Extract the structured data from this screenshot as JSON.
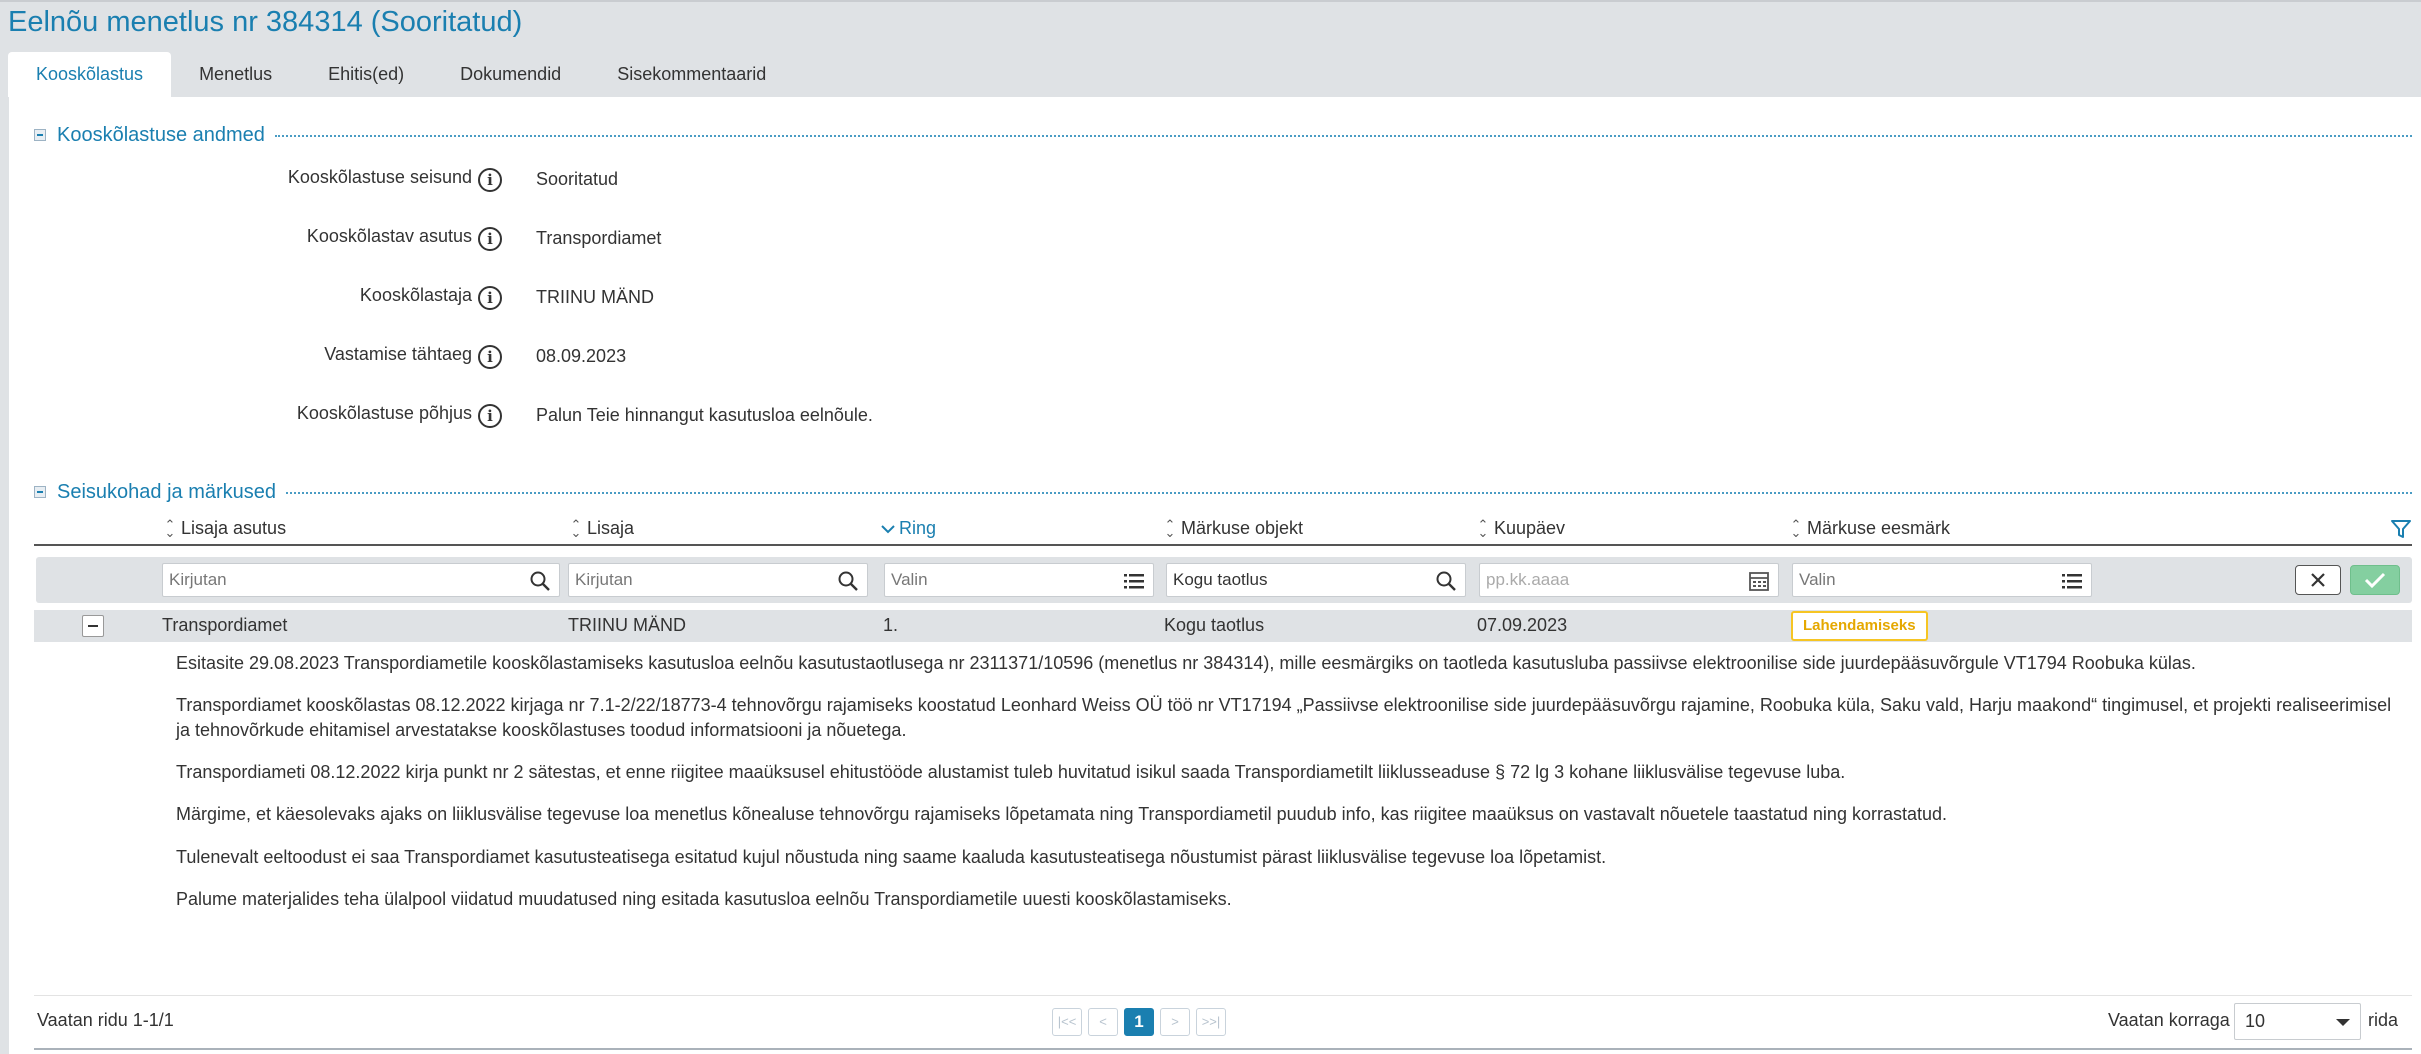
{
  "page": {
    "title": "Eelnõu menetlus nr 384314 (Sooritatud)",
    "tabs": [
      "Kooskõlastus",
      "Menetlus",
      "Ehitis(ed)",
      "Dokumendid",
      "Sisekommentaarid"
    ],
    "active_tab": "Kooskõlastus"
  },
  "details": {
    "section_title": "Kooskõlastuse andmed",
    "fields": [
      {
        "label": "Kooskõlastuse seisund",
        "value": "Sooritatud"
      },
      {
        "label": "Kooskõlastav asutus",
        "value": "Transpordiamet"
      },
      {
        "label": "Kooskõlastaja",
        "value": "TRIINU MÄND"
      },
      {
        "label": "Vastamise tähtaeg",
        "value": "08.09.2023"
      },
      {
        "label": "Kooskõlastuse põhjus",
        "value": "Palun Teie hinnangut kasutusloa eelnõule."
      }
    ]
  },
  "remarks": {
    "section_title": "Seisukohad ja märkused",
    "columns": [
      "Lisaja asutus",
      "Lisaja",
      "Ring",
      "Märkuse objekt",
      "Kuupäev",
      "Märkuse eesmärk"
    ],
    "sorted_column": "Ring",
    "filters": [
      {
        "placeholder": "Kirjutan",
        "icon": "search-icon"
      },
      {
        "placeholder": "Kirjutan",
        "icon": "search-icon"
      },
      {
        "placeholder": "Valin",
        "icon": "list-icon"
      },
      {
        "value": "Kogu taotlus",
        "icon": "search-icon"
      },
      {
        "placeholder": "pp.kk.aaaa",
        "icon": "calendar-icon"
      },
      {
        "placeholder": "Valin",
        "icon": "list-icon"
      }
    ],
    "row": {
      "asutus": "Transpordiamet",
      "lisaja": "TRIINU MÄND",
      "ring": "1.",
      "objekt": "Kogu taotlus",
      "kuupaev": "07.09.2023",
      "eesmark": "Lahendamiseks"
    },
    "comment_paragraphs": [
      "Esitasite 29.08.2023 Transpordiametile kooskõlastamiseks kasutusloa eelnõu kasutustaotlusega nr 2311371/10596 (menetlus nr 384314), mille eesmärgiks on taotleda kasutusluba passiivse elektroonilise side juurdepääsuvõrgule VT1794 Roobuka külas.",
      "Transpordiamet kooskõlastas 08.12.2022 kirjaga nr 7.1-2/22/18773-4 tehnovõrgu rajamiseks koostatud Leonhard Weiss OÜ töö nr VT17194 „Passiivse elektroonilise side juurdepääsuvõrgu rajamine, Roobuka küla, Saku vald, Harju maakond“ tingimusel, et  projekti realiseerimisel ja tehnovõrkude ehitamisel arvestatakse kooskõlastuses toodud informatsiooni ja nõuetega.",
      "Transpordiameti 08.12.2022 kirja punkt nr 2 sätestas, et enne riigitee maaüksusel ehitustööde alustamist tuleb huvitatud isikul saada Transpordiametilt liiklusseaduse § 72 lg 3 kohane liiklusvälise tegevuse luba.",
      "Märgime, et käesolevaks ajaks on liiklusvälise tegevuse loa menetlus kõnealuse tehnovõrgu rajamiseks lõpetamata ning Transpordiametil puudub info, kas riigitee maaüksus on vastavalt nõuetele taastatud ning korrastatud.",
      "Tulenevalt eeltoodust ei saa Transpordiamet kasutusteatisega esitatud kujul nõustuda ning saame kaaluda kasutusteatisega nõustumist pärast liiklusvälise tegevuse loa lõpetamist.",
      "Palume materjalides teha ülalpool viidatud muudatused ning esitada kasutusloa eelnõu Transpordiametile uuesti kooskõlastamiseks."
    ]
  },
  "footer": {
    "rows_info": "Vaatan ridu 1-1/1",
    "current_page": "1",
    "per_page_label": "Vaatan korraga",
    "per_page_value": "10",
    "per_page_suffix": "rida"
  },
  "colors": {
    "accent": "#1a7fb0",
    "header_bg": "#dfe2e5",
    "badge_border": "#f6c523",
    "ok_button": "#84cfa0"
  }
}
